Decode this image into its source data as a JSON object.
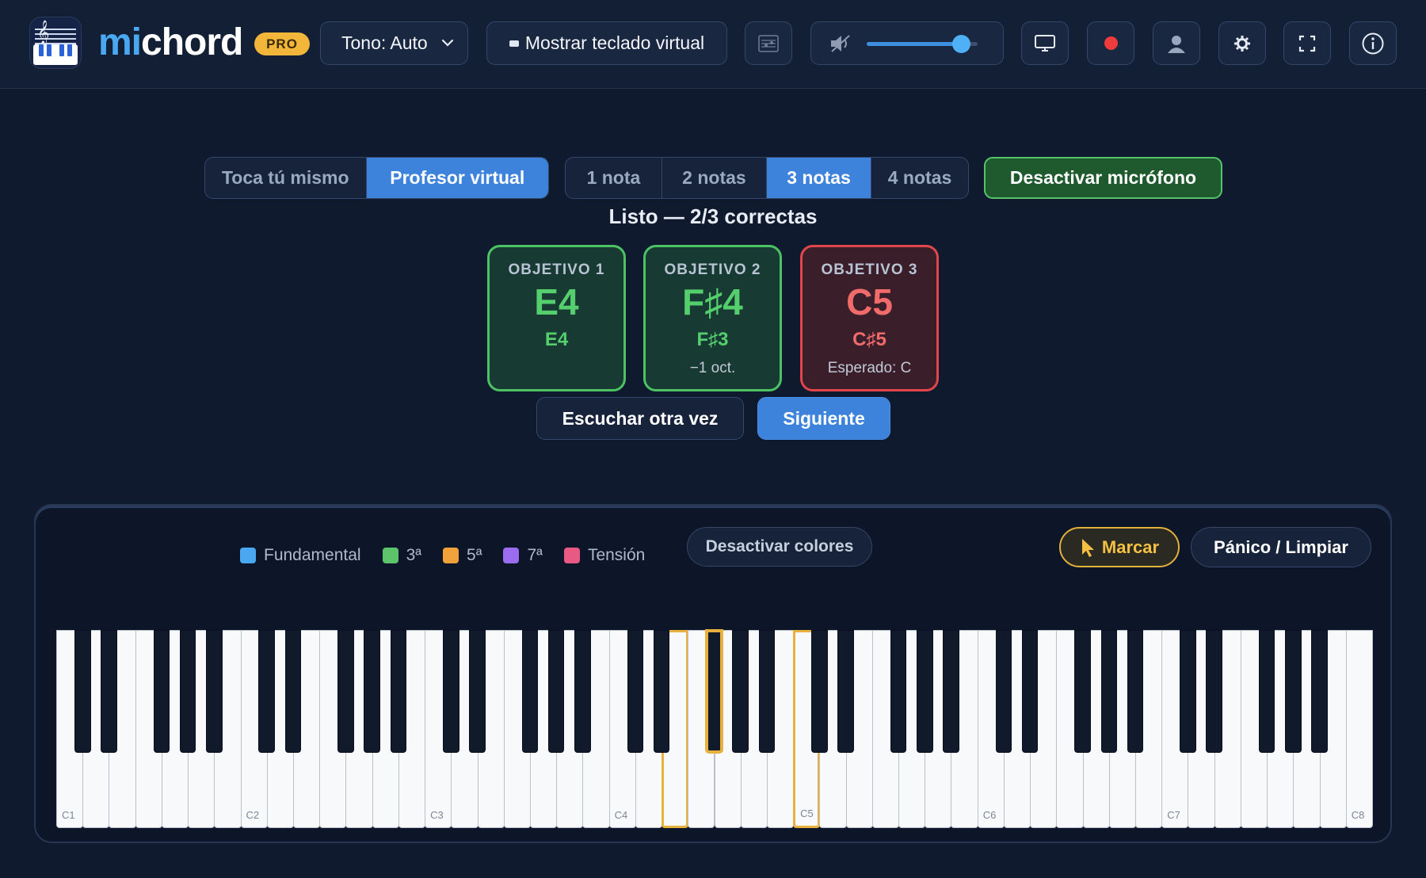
{
  "app": {
    "brand_prefix": "mi",
    "brand_suffix": "chord",
    "badge": "PRO"
  },
  "toolbar": {
    "tone_label": "Tono: Auto",
    "keyboard_toggle_label": "Mostrar teclado virtual",
    "volume_level": 0.86,
    "icons": [
      "sheet-music-icon",
      "speaker-icon",
      "display-icon",
      "record-icon",
      "user-icon",
      "gear-icon",
      "fullscreen-icon",
      "info-icon"
    ]
  },
  "mode": {
    "options": [
      "Toca tú mismo",
      "Profesor virtual"
    ],
    "active": 1
  },
  "note_count": {
    "options": [
      "1 nota",
      "2 notas",
      "3 notas",
      "4 notas"
    ],
    "active": 2
  },
  "mic_button": "Desactivar micrófono",
  "status": "Listo — 2/3 correctas",
  "targets": [
    {
      "label": "OBJETIVO 1",
      "note": "E4",
      "played": "E4",
      "hint": "",
      "result": "correct"
    },
    {
      "label": "OBJETIVO 2",
      "note": "F♯4",
      "played": "F♯3",
      "hint": "−1 oct.",
      "result": "correct"
    },
    {
      "label": "OBJETIVO 3",
      "note": "C5",
      "played": "C♯5",
      "hint": "Esperado: C",
      "result": "wrong"
    }
  ],
  "actions": {
    "replay": "Escuchar otra vez",
    "next": "Siguiente"
  },
  "legend": [
    {
      "label": "Fundamental",
      "color": "#4aa8f0"
    },
    {
      "label": "3ª",
      "color": "#5cc36b"
    },
    {
      "label": "5ª",
      "color": "#f0a23a"
    },
    {
      "label": "7ª",
      "color": "#9b6cf0"
    },
    {
      "label": "Tensión",
      "color": "#e85a84"
    }
  ],
  "keyboard_controls": {
    "colors_toggle": "Desactivar colores",
    "mark": "Marcar",
    "panic": "Pánico / Limpiar"
  },
  "keyboard": {
    "octave_labels": [
      "C1",
      "C2",
      "C3",
      "C4",
      "C5",
      "C6",
      "C7",
      "C8"
    ],
    "marked_keys": [
      "E4",
      "F#4",
      "C5"
    ],
    "accent": "#e8b13e"
  }
}
